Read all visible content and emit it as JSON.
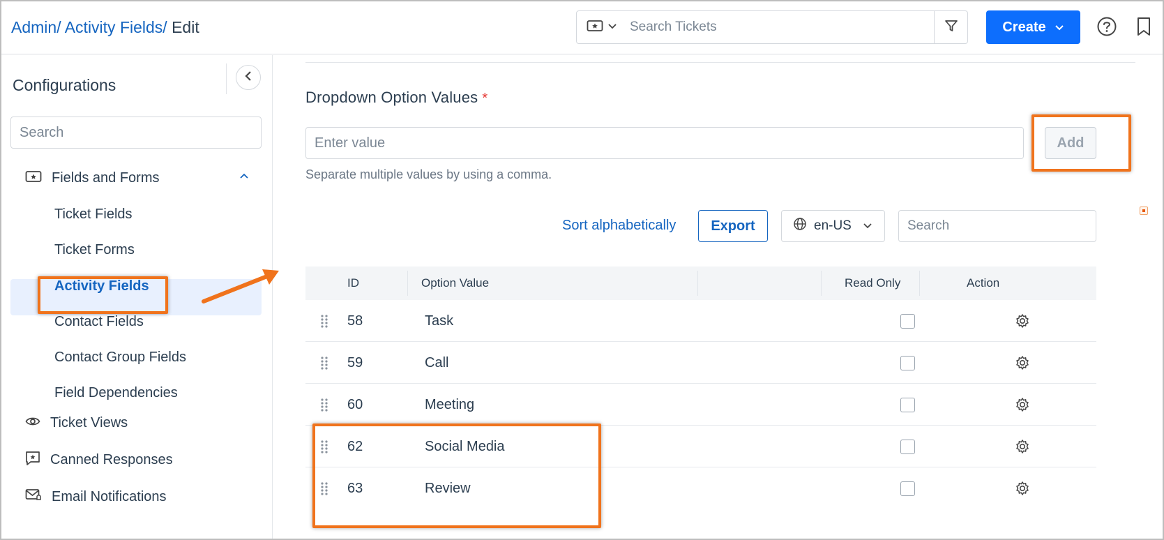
{
  "header": {
    "breadcrumb": [
      "Admin/",
      "Activity Fields/",
      "Edit"
    ],
    "search_placeholder": "Search Tickets",
    "create_label": "Create"
  },
  "sidebar": {
    "title": "Configurations",
    "search_placeholder": "Search",
    "group_fields": {
      "label": "Fields and Forms",
      "items": [
        "Ticket Fields",
        "Ticket Forms",
        "Activity Fields",
        "Contact Fields",
        "Contact Group Fields",
        "Field Dependencies"
      ],
      "active_index": 2
    },
    "items": [
      {
        "label": "Ticket Views",
        "icon": "eye-icon"
      },
      {
        "label": "Canned Responses",
        "icon": "chat-star-icon"
      },
      {
        "label": "Email Notifications",
        "icon": "email-bell-icon"
      }
    ]
  },
  "main": {
    "section_title": "Dropdown Option Values",
    "required_mark": "*",
    "value_placeholder": "Enter value",
    "add_label": "Add",
    "hint": "Separate multiple values by using a comma.",
    "sort_label": "Sort alphabetically",
    "export_label": "Export",
    "locale": "en-US",
    "table_search_placeholder": "Search",
    "table": {
      "columns": [
        "ID",
        "Option Value",
        "Read Only",
        "Action"
      ],
      "rows": [
        {
          "id": "58",
          "value": "Task",
          "read_only": false
        },
        {
          "id": "59",
          "value": "Call",
          "read_only": false
        },
        {
          "id": "60",
          "value": "Meeting",
          "read_only": false
        },
        {
          "id": "62",
          "value": "Social Media",
          "read_only": false
        },
        {
          "id": "63",
          "value": "Review",
          "read_only": false
        }
      ]
    }
  },
  "colors": {
    "primary": "#0d6efd",
    "link": "#1565c0",
    "highlight": "#f0731c",
    "active_bg": "#e8f0fe"
  }
}
